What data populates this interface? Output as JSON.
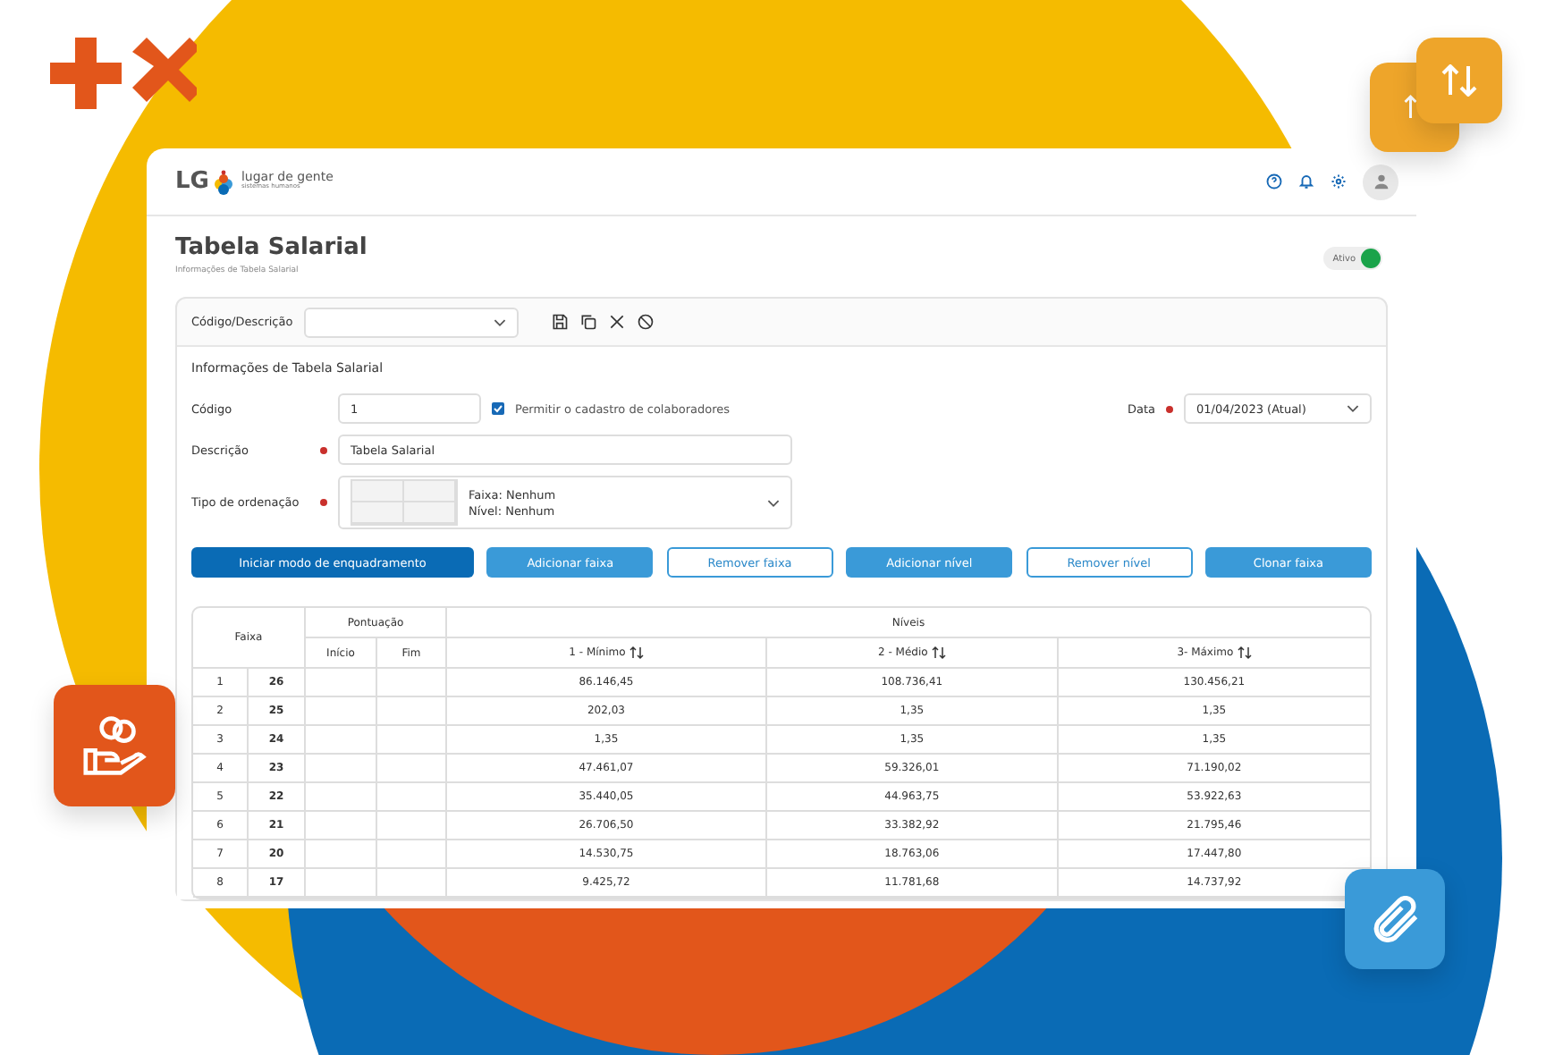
{
  "logo": {
    "mark": "LG",
    "name": "lugar de gente",
    "tagline": "sistemas humanos"
  },
  "page": {
    "title": "Tabela Salarial",
    "subtitle": "Informações de Tabela Salarial",
    "status": {
      "label": "Ativo",
      "on": true
    }
  },
  "toolbar": {
    "label": "Código/Descrição"
  },
  "form": {
    "title": "Informações de Tabela Salarial",
    "codigo": {
      "label": "Código",
      "value": "1"
    },
    "permitir": {
      "label": "Permitir o cadastro de colaboradores",
      "checked": true
    },
    "data": {
      "label": "Data",
      "value": "01/04/2023 (Atual)",
      "required": true
    },
    "descricao": {
      "label": "Descrição",
      "value": "Tabela Salarial",
      "required": true
    },
    "ordenacao": {
      "label": "Tipo de ordenação",
      "required": true,
      "lines": [
        "Faixa: Nenhum",
        "Nível: Nenhum"
      ]
    }
  },
  "buttons": [
    {
      "label": "Iniciar modo de enquadramento",
      "kind": "primary"
    },
    {
      "label": "Adicionar faixa",
      "kind": "secondary"
    },
    {
      "label": "Remover faixa",
      "kind": "outline"
    },
    {
      "label": "Adicionar nível",
      "kind": "secondary"
    },
    {
      "label": "Remover nível",
      "kind": "outline"
    },
    {
      "label": "Clonar faixa",
      "kind": "secondary"
    }
  ],
  "table": {
    "faixa": "Faixa",
    "pontuacao": "Pontuação",
    "niveis": "Níveis",
    "inicio": "Início",
    "fim": "Fim",
    "levels": [
      "1 -  Mínimo",
      "2 - Médio",
      "3- Máximo"
    ],
    "rows": [
      {
        "n": "1",
        "code": "26",
        "values": [
          "86.146,45",
          "108.736,41",
          "130.456,21"
        ]
      },
      {
        "n": "2",
        "code": "25",
        "values": [
          "202,03",
          "1,35",
          "1,35"
        ]
      },
      {
        "n": "3",
        "code": "24",
        "values": [
          "1,35",
          "1,35",
          "1,35"
        ]
      },
      {
        "n": "4",
        "code": "23",
        "values": [
          "47.461,07",
          "59.326,01",
          "71.190,02"
        ]
      },
      {
        "n": "5",
        "code": "22",
        "values": [
          "35.440,05",
          "44.963,75",
          "53.922,63"
        ]
      },
      {
        "n": "6",
        "code": "21",
        "values": [
          "26.706,50",
          "33.382,92",
          "21.795,46"
        ]
      },
      {
        "n": "7",
        "code": "20",
        "values": [
          "14.530,75",
          "18.763,06",
          "17.447,80"
        ]
      },
      {
        "n": "8",
        "code": "17",
        "values": [
          "9.425,72",
          "11.781,68",
          "14.737,92"
        ]
      }
    ]
  }
}
